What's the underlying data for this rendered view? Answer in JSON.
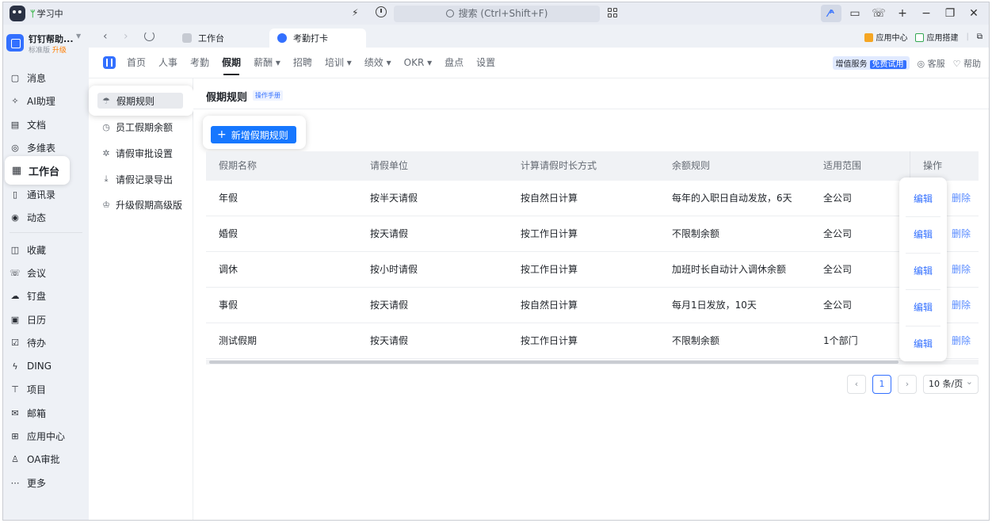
{
  "titlebar": {
    "study_label": "学习中",
    "search_placeholder": "搜索 (Ctrl+Shift+F)"
  },
  "org": {
    "name": "钉钉帮助...",
    "plan": "标准版",
    "upgrade": "升级"
  },
  "leftnav": [
    {
      "label": "消息",
      "icon": "message-icon"
    },
    {
      "label": "AI助理",
      "icon": "ai-assistant-icon"
    },
    {
      "label": "文档",
      "icon": "document-icon"
    },
    {
      "label": "多维表",
      "icon": "multi-table-icon"
    },
    {
      "label": "工作台",
      "icon": "workbench-icon"
    },
    {
      "label": "通讯录",
      "icon": "contacts-icon"
    },
    {
      "label": "动态",
      "icon": "moments-icon"
    },
    {
      "label": "收藏",
      "icon": "favorites-icon"
    },
    {
      "label": "会议",
      "icon": "meeting-icon"
    },
    {
      "label": "钉盘",
      "icon": "cloud-drive-icon"
    },
    {
      "label": "日历",
      "icon": "calendar-icon"
    },
    {
      "label": "待办",
      "icon": "todo-icon"
    },
    {
      "label": "DING",
      "icon": "ding-icon"
    },
    {
      "label": "项目",
      "icon": "project-icon"
    },
    {
      "label": "邮箱",
      "icon": "mail-icon"
    },
    {
      "label": "应用中心",
      "icon": "app-center-icon"
    },
    {
      "label": "OA审批",
      "icon": "approval-icon"
    },
    {
      "label": "更多",
      "icon": "more-icon"
    }
  ],
  "tabs": [
    {
      "label": "工作台"
    },
    {
      "label": "考勤打卡"
    }
  ],
  "tabstrip_right": {
    "app_center": "应用中心",
    "app_builder": "应用搭建"
  },
  "topnav": [
    "首页",
    "人事",
    "考勤",
    "假期",
    "薪酬",
    "招聘",
    "培训",
    "绩效",
    "OKR",
    "盘点",
    "设置"
  ],
  "header_right": {
    "vas": "增值服务",
    "trial": "免费试用",
    "service": "客服",
    "help": "帮助"
  },
  "subnav": [
    {
      "label": "假期规则",
      "icon": "umbrella-icon"
    },
    {
      "label": "员工假期余额",
      "icon": "clock-icon"
    },
    {
      "label": "请假审批设置",
      "icon": "gear-icon"
    },
    {
      "label": "请假记录导出",
      "icon": "download-icon"
    },
    {
      "label": "升级假期高级版",
      "icon": "crown-icon"
    }
  ],
  "page": {
    "title": "假期规则",
    "manual": "操作手册",
    "add_button": "新增假期规则"
  },
  "table": {
    "headers": [
      "假期名称",
      "请假单位",
      "计算请假时长方式",
      "余额规则",
      "适用范围",
      "操作"
    ],
    "rows": [
      {
        "name": "年假",
        "unit": "按半天请假",
        "method": "按自然日计算",
        "balance": "每年的入职日自动发放，6天",
        "scope": "全公司"
      },
      {
        "name": "婚假",
        "unit": "按天请假",
        "method": "按工作日计算",
        "balance": "不限制余额",
        "scope": "全公司"
      },
      {
        "name": "调休",
        "unit": "按小时请假",
        "method": "按工作日计算",
        "balance": "加班时长自动计入调休余额",
        "scope": "全公司"
      },
      {
        "name": "事假",
        "unit": "按天请假",
        "method": "按自然日计算",
        "balance": "每月1日发放，10天",
        "scope": "全公司"
      },
      {
        "name": "测试假期",
        "unit": "按天请假",
        "method": "按工作日计算",
        "balance": "不限制余额",
        "scope": "1个部门"
      }
    ],
    "edit_label": "编辑",
    "delete_label": "删除"
  },
  "pager": {
    "current": "1",
    "page_size": "10 条/页"
  },
  "colors": {
    "accent": "#3370ff",
    "button": "#1677ff",
    "nav_bg": "#eef1f6"
  }
}
